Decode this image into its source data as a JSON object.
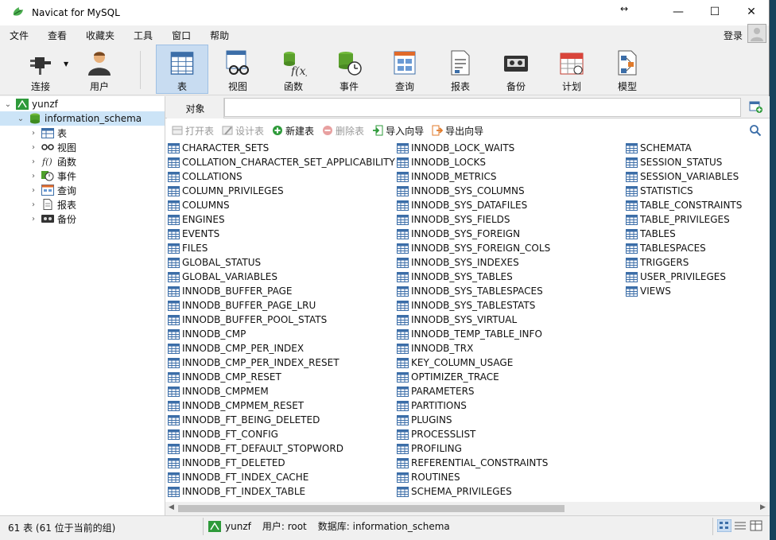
{
  "window": {
    "title": "Navicat for MySQL"
  },
  "menu": [
    "文件",
    "查看",
    "收藏夹",
    "工具",
    "窗口",
    "帮助"
  ],
  "login_label": "登录",
  "toolbar": [
    {
      "label": "连接",
      "icon": "connection-plug-icon"
    },
    {
      "label": "用户",
      "icon": "user-icon"
    },
    {
      "label": "表",
      "icon": "table-icon"
    },
    {
      "label": "视图",
      "icon": "view-glasses-icon"
    },
    {
      "label": "函数",
      "icon": "function-icon"
    },
    {
      "label": "事件",
      "icon": "event-clock-icon"
    },
    {
      "label": "查询",
      "icon": "query-icon"
    },
    {
      "label": "报表",
      "icon": "report-icon"
    },
    {
      "label": "备份",
      "icon": "backup-icon"
    },
    {
      "label": "计划",
      "icon": "schedule-calendar-icon"
    },
    {
      "label": "模型",
      "icon": "model-icon"
    }
  ],
  "tree": {
    "connection": "yunzf",
    "database": "information_schema",
    "children": [
      "表",
      "视图",
      "函数",
      "事件",
      "查询",
      "报表",
      "备份"
    ]
  },
  "object_tab": "对象",
  "actions": [
    {
      "label": "打开表",
      "disabled": true
    },
    {
      "label": "设计表",
      "disabled": true
    },
    {
      "label": "新建表",
      "disabled": false
    },
    {
      "label": "删除表",
      "disabled": true
    },
    {
      "label": "导入向导",
      "disabled": false
    },
    {
      "label": "导出向导",
      "disabled": false
    }
  ],
  "tables_col1": [
    "CHARACTER_SETS",
    "COLLATION_CHARACTER_SET_APPLICABILITY",
    "COLLATIONS",
    "COLUMN_PRIVILEGES",
    "COLUMNS",
    "ENGINES",
    "EVENTS",
    "FILES",
    "GLOBAL_STATUS",
    "GLOBAL_VARIABLES",
    "INNODB_BUFFER_PAGE",
    "INNODB_BUFFER_PAGE_LRU",
    "INNODB_BUFFER_POOL_STATS",
    "INNODB_CMP",
    "INNODB_CMP_PER_INDEX",
    "INNODB_CMP_PER_INDEX_RESET",
    "INNODB_CMP_RESET",
    "INNODB_CMPMEM",
    "INNODB_CMPMEM_RESET",
    "INNODB_FT_BEING_DELETED",
    "INNODB_FT_CONFIG",
    "INNODB_FT_DEFAULT_STOPWORD",
    "INNODB_FT_DELETED",
    "INNODB_FT_INDEX_CACHE",
    "INNODB_FT_INDEX_TABLE"
  ],
  "tables_col2": [
    "INNODB_LOCK_WAITS",
    "INNODB_LOCKS",
    "INNODB_METRICS",
    "INNODB_SYS_COLUMNS",
    "INNODB_SYS_DATAFILES",
    "INNODB_SYS_FIELDS",
    "INNODB_SYS_FOREIGN",
    "INNODB_SYS_FOREIGN_COLS",
    "INNODB_SYS_INDEXES",
    "INNODB_SYS_TABLES",
    "INNODB_SYS_TABLESPACES",
    "INNODB_SYS_TABLESTATS",
    "INNODB_SYS_VIRTUAL",
    "INNODB_TEMP_TABLE_INFO",
    "INNODB_TRX",
    "KEY_COLUMN_USAGE",
    "OPTIMIZER_TRACE",
    "PARAMETERS",
    "PARTITIONS",
    "PLUGINS",
    "PROCESSLIST",
    "PROFILING",
    "REFERENTIAL_CONSTRAINTS",
    "ROUTINES",
    "SCHEMA_PRIVILEGES"
  ],
  "tables_col3": [
    "SCHEMATA",
    "SESSION_STATUS",
    "SESSION_VARIABLES",
    "STATISTICS",
    "TABLE_CONSTRAINTS",
    "TABLE_PRIVILEGES",
    "TABLES",
    "TABLESPACES",
    "TRIGGERS",
    "USER_PRIVILEGES",
    "VIEWS"
  ],
  "status": {
    "count_text": "61 表 (61 位于当前的组)",
    "connection": "yunzf",
    "user": "用户: root",
    "database": "数据库: information_schema"
  },
  "colors": {
    "accent": "#c8dcf1",
    "selected": "#cce4f7",
    "tree_green": "#2e9a3a"
  }
}
